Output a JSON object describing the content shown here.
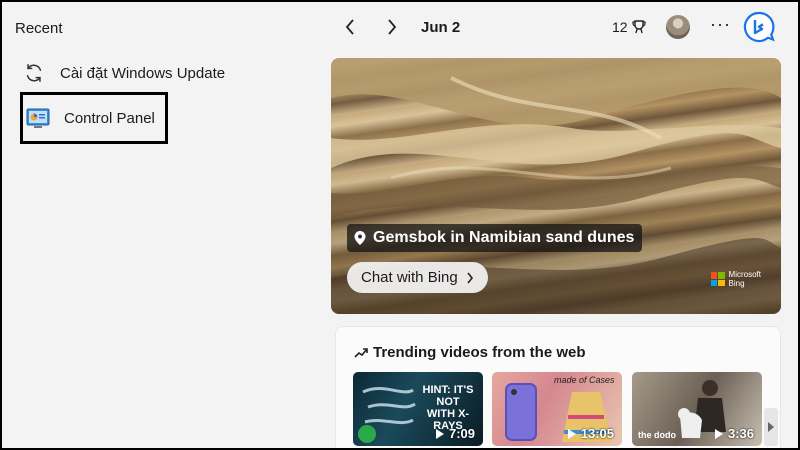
{
  "recent": {
    "title": "Recent",
    "items": [
      {
        "label": "Cài đặt Windows Update",
        "icon": "refresh-icon"
      },
      {
        "label": "Control Panel",
        "icon": "control-panel-icon"
      }
    ]
  },
  "header": {
    "date": "Jun 2",
    "rewards_count": "12",
    "rewards_icon": "rewards-trophy-icon",
    "more": "···"
  },
  "hero": {
    "caption": "Gemsbok in Namibian sand dunes",
    "chat_button": "Chat with Bing",
    "brand_line1": "Microsoft",
    "brand_line2": "Bing"
  },
  "trending": {
    "title": "Trending videos from the web",
    "videos": [
      {
        "duration": "7:09",
        "overlay_text": "HINT: IT'S NOT WITH X-RAYS"
      },
      {
        "duration": "13:05",
        "overlay_text": "made of Cases"
      },
      {
        "duration": "3:36",
        "overlay_text": "the dodo"
      }
    ]
  },
  "colors": {
    "background": "#f3f3f3",
    "bing_blue": "#1a73e8",
    "highlight_border": "#000000"
  }
}
